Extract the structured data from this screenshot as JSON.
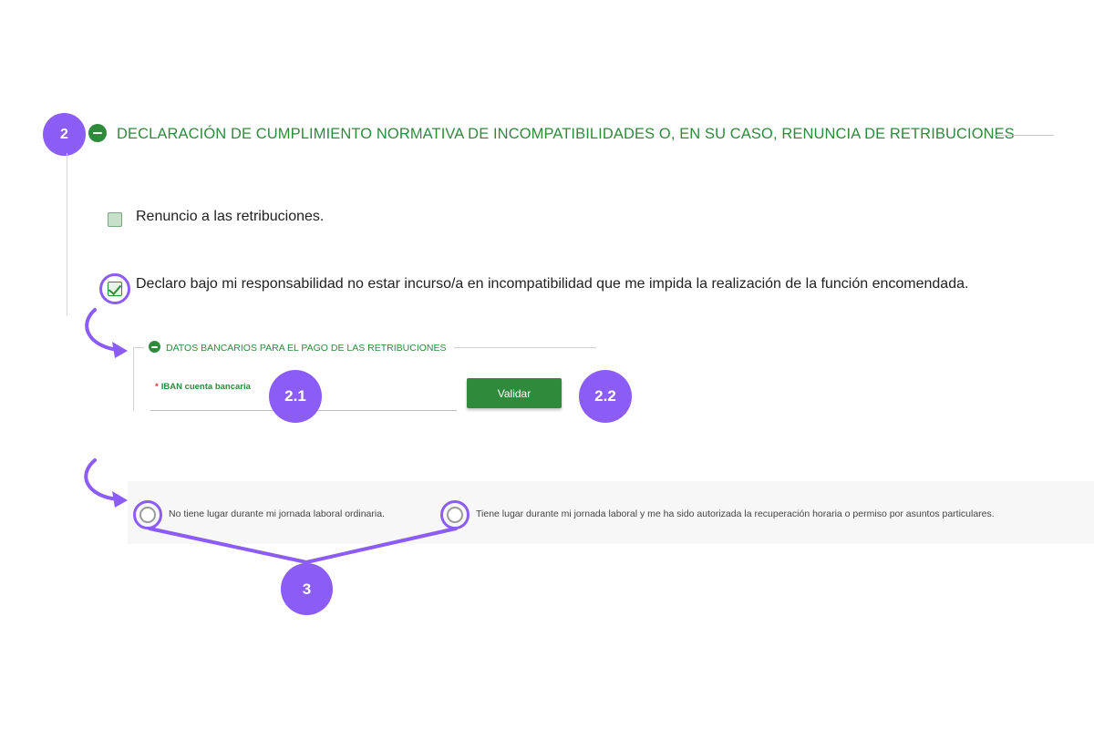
{
  "section": {
    "title": "DECLARACIÓN DE CUMPLIMIENTO NORMATIVA DE INCOMPATIBILIDADES O, EN SU CASO, RENUNCIA DE RETRIBUCIONES",
    "step_badge": "2"
  },
  "options": {
    "renuncia_label": "Renuncio a las retribuciones.",
    "declaro_label": "Declaro bajo mi responsabilidad no estar incurso/a en incompatibilidad que me impida la realización de la función encomendada."
  },
  "bank": {
    "title": "DATOS BANCARIOS PARA EL PAGO DE LAS RETRIBUCIONES",
    "required_mark": "*",
    "iban_label": "IBAN cuenta bancaria",
    "iban_value": "",
    "validate_label": "Validar",
    "badge_iban": "2.1",
    "badge_validate": "2.2"
  },
  "schedule": {
    "option1": "No tiene lugar durante mi jornada laboral ordinaria.",
    "option2": "Tiene lugar durante mi jornada laboral y me ha sido autorizada la recuperación horaria o permiso por asuntos particulares.",
    "badge": "3"
  },
  "colors": {
    "brand_green": "#2f8a3c",
    "annotation_purple": "#8b5cf6"
  }
}
